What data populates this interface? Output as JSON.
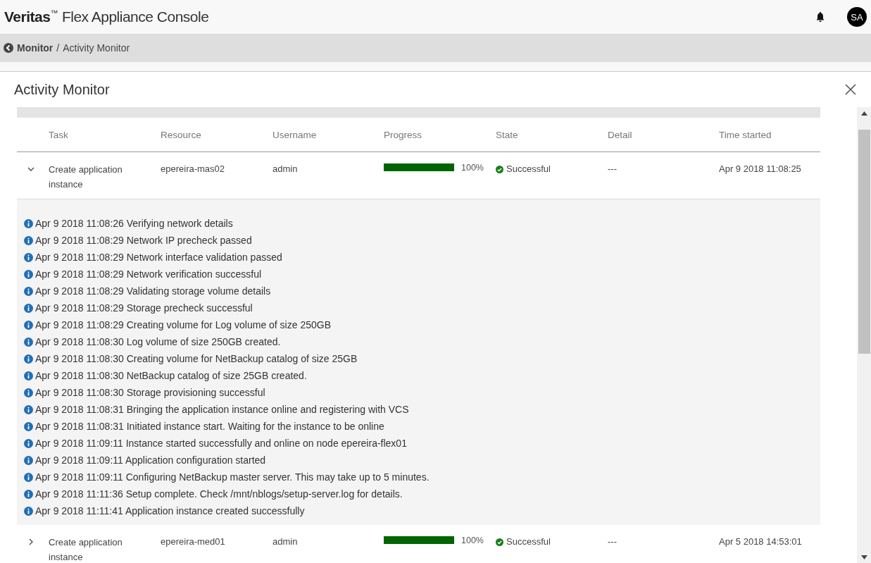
{
  "header": {
    "brand": "Veritas",
    "trademark": "™",
    "title": "Flex Appliance Console",
    "avatar": "SA"
  },
  "breadcrumb": {
    "parent": "Monitor",
    "separator": "/",
    "current": "Activity Monitor"
  },
  "panel": {
    "title": "Activity Monitor"
  },
  "table": {
    "columns": [
      "Task",
      "Resource",
      "Username",
      "Progress",
      "State",
      "Detail",
      "Time started"
    ],
    "rows": [
      {
        "expanded": true,
        "task": "Create application instance",
        "resource": "epereira-mas02",
        "username": "admin",
        "level": 1,
        "progress": "100%",
        "state": {
          "kind": "success",
          "label": "Successful"
        },
        "detail": "---",
        "time_started": "Apr 9 2018 11:08:25",
        "log": [
          "Apr 9 2018 11:08:26 Verifying network details",
          "Apr 9 2018 11:08:29 Network IP precheck passed",
          "Apr 9 2018 11:08:29 Network interface validation passed",
          "Apr 9 2018 11:08:29 Network verification successful",
          "Apr 9 2018 11:08:29 Validating storage volume details",
          "Apr 9 2018 11:08:29 Storage precheck successful",
          "Apr 9 2018 11:08:29 Creating volume for Log volume of size 250GB",
          "Apr 9 2018 11:08:30 Log volume of size 250GB created.",
          "Apr 9 2018 11:08:30 Creating volume for NetBackup catalog of size 25GB",
          "Apr 9 2018 11:08:30 NetBackup catalog of size 25GB created.",
          "Apr 9 2018 11:08:30 Storage provisioning successful",
          "Apr 9 2018 11:08:31 Bringing the application instance online and registering with VCS",
          "Apr 9 2018 11:08:31 Initiated instance start. Waiting for the instance to be online",
          "Apr 9 2018 11:09:11 Instance started successfully and online on node epereira-flex01",
          "Apr 9 2018 11:09:11 Application configuration started",
          "Apr 9 2018 11:09:11 Configuring NetBackup master server. This may take up to 5 minutes.",
          "Apr 9 2018 11:11:36 Setup complete. Check /mnt/nblogs/setup-server.log for details.",
          "Apr 9 2018 11:11:41 Application instance created successfully"
        ]
      },
      {
        "expanded": false,
        "task": "Create application instance",
        "resource": "epereira-med01",
        "username": "admin",
        "level": 1,
        "progress": "100%",
        "state": {
          "kind": "success",
          "label": "Successful"
        },
        "detail": "---",
        "time_started": "Apr 5 2018 14:53:01"
      }
    ]
  }
}
